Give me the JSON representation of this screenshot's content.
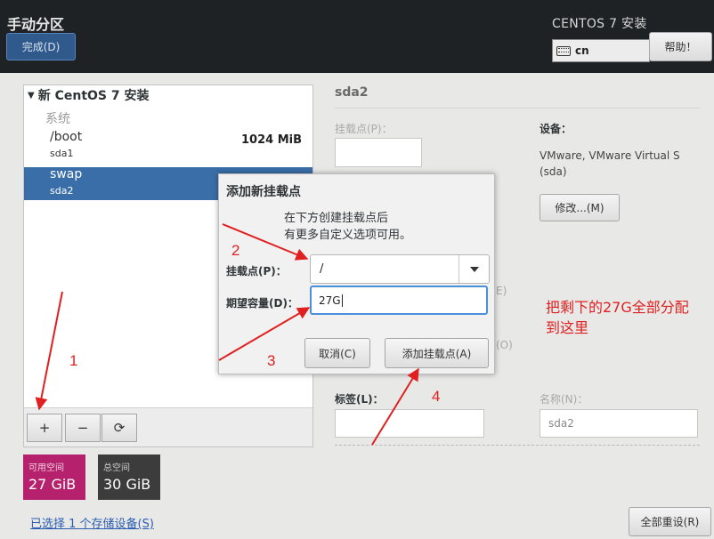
{
  "header": {
    "title": "手动分区",
    "done_label": "完成(D)",
    "product": "CENTOS 7 安装",
    "keyboard_layout": "cn",
    "help_label": "帮助！"
  },
  "left_panel": {
    "installation_title": "新 CentOS 7 安装",
    "section_label": "系统",
    "mount_points": [
      {
        "name": "/boot",
        "device": "sda1",
        "size": "1024 MiB",
        "selected": false
      },
      {
        "name": "swap",
        "device": "sda2",
        "size": "",
        "selected": true
      }
    ],
    "toolbar": {
      "add": "+",
      "remove": "−",
      "refresh": "⟳"
    }
  },
  "space": {
    "available_label": "可用空间",
    "available_value": "27 GiB",
    "total_label": "总空间",
    "total_value": "30 GiB"
  },
  "storage_link": "已选择 1 个存储设备(S)",
  "reset_label": "全部重设(R)",
  "right_panel": {
    "device_title": "sda2",
    "mount_point_label": "挂载点(P)：",
    "devices_label": "设备：",
    "devices_value_line1": "VMware, VMware Virtual S",
    "devices_value_line2": "(sda)",
    "modify_label": "修改...(M)",
    "fragment_e": "E)",
    "fragment_o": "(O)",
    "label_label": "标签(L)：",
    "name_label": "名称(N)：",
    "name_value": "sda2"
  },
  "dialog": {
    "title": "添加新挂载点",
    "desc_line1": "在下方创建挂载点后",
    "desc_line2": "有更多自定义选项可用。",
    "mount_point_label": "挂载点(P)：",
    "mount_point_value": "/",
    "capacity_label": "期望容量(D)：",
    "capacity_value": "27G",
    "cancel_label": "取消(C)",
    "add_label": "添加挂载点(A)"
  },
  "annotations": {
    "num1": "1",
    "num2": "2",
    "num3": "3",
    "num4": "4",
    "note_line1": "把剩下的27G全部分配",
    "note_line2": "到这里",
    "color": "#e02020"
  },
  "colors": {
    "header_bg": "#1f2224",
    "done_button": "#30598c",
    "selected_row": "#3a6ea8",
    "available_space": "#b5216c",
    "total_space": "#3c3c3c",
    "focus_border": "#4a90d9"
  }
}
